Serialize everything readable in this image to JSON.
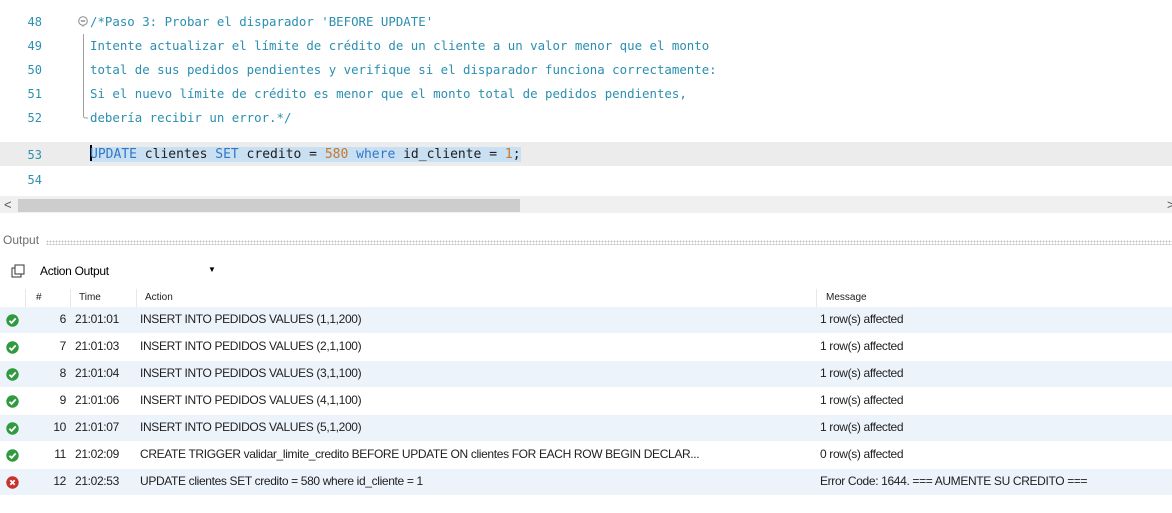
{
  "editor": {
    "lines": [
      {
        "num": "48",
        "text": "/*Paso 3: Probar el disparador 'BEFORE UPDATE'"
      },
      {
        "num": "49",
        "text": "Intente actualizar el límite de crédito de un cliente a un valor menor que el monto"
      },
      {
        "num": "50",
        "text": "total de sus pedidos pendientes y verifique si el disparador funciona correctamente:"
      },
      {
        "num": "51",
        "text": "Si el nuevo límite de crédito es menor que el monto total de pedidos pendientes,"
      },
      {
        "num": "52",
        "text": "debería recibir un error.*/"
      },
      {
        "num": "53",
        "kw1": "UPDATE",
        "t1": " clientes ",
        "kw2": "SET",
        "t2": " credito = ",
        "n1": "580",
        "t3": " ",
        "kw3": "where",
        "t4": " id_cliente = ",
        "n2": "1",
        "t5": ";"
      },
      {
        "num": "54",
        "text": ""
      }
    ],
    "scroll_left": "<",
    "scroll_right": ">"
  },
  "output": {
    "title": "Output",
    "selector": "Action Output",
    "columns": {
      "num": "#",
      "time": "Time",
      "action": "Action",
      "message": "Message"
    },
    "rows": [
      {
        "status": "ok",
        "num": "6",
        "time": "21:01:01",
        "action": "INSERT INTO PEDIDOS VALUES (1,1,200)",
        "message": "1 row(s) affected"
      },
      {
        "status": "ok",
        "num": "7",
        "time": "21:01:03",
        "action": "INSERT INTO PEDIDOS VALUES (2,1,100)",
        "message": "1 row(s) affected"
      },
      {
        "status": "ok",
        "num": "8",
        "time": "21:01:04",
        "action": "INSERT INTO PEDIDOS VALUES (3,1,100)",
        "message": "1 row(s) affected"
      },
      {
        "status": "ok",
        "num": "9",
        "time": "21:01:06",
        "action": "INSERT INTO PEDIDOS VALUES (4,1,100)",
        "message": "1 row(s) affected"
      },
      {
        "status": "ok",
        "num": "10",
        "time": "21:01:07",
        "action": "INSERT INTO PEDIDOS VALUES (5,1,200)",
        "message": "1 row(s) affected"
      },
      {
        "status": "ok",
        "num": "11",
        "time": "21:02:09",
        "action": "CREATE TRIGGER validar_limite_credito BEFORE UPDATE ON clientes   FOR EACH ROW   BEGIN DECLAR...",
        "message": "0 row(s) affected"
      },
      {
        "status": "error",
        "num": "12",
        "time": "21:02:53",
        "action": "UPDATE clientes SET credito = 580 where id_cliente = 1",
        "message": "Error Code: 1644. === AUMENTE SU CREDITO ==="
      }
    ]
  },
  "colors": {
    "ok": "#2f9a3e",
    "error": "#c9312b",
    "keyword": "#2f78c8",
    "number": "#c8762c",
    "comment": "#2b8fb0"
  }
}
